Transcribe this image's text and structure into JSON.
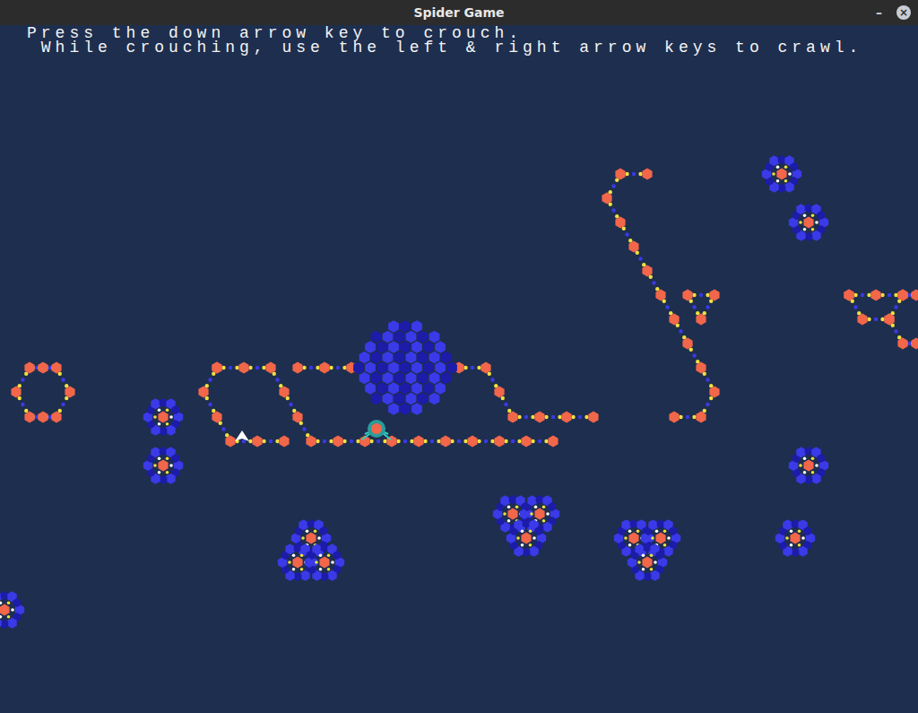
{
  "window": {
    "title": "Spider Game",
    "buttons": [
      "–",
      "×"
    ]
  },
  "instructions": [
    "Press the down arrow key to crouch.",
    " While crouching, use the left & right arrow keys to crawl."
  ]
}
